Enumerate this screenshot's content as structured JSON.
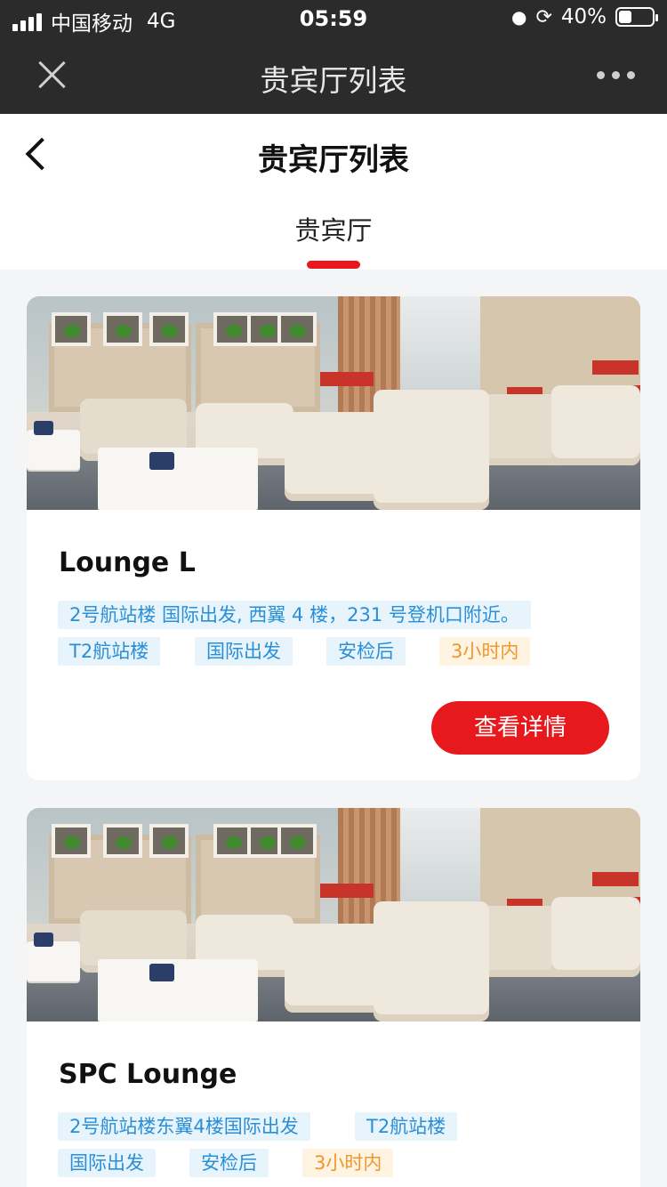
{
  "status_bar": {
    "carrier": "中国移动",
    "network": "4G",
    "time": "05:59",
    "battery_text": "40%",
    "battery_level": 0.4
  },
  "wechat_bar": {
    "title": "贵宾厅列表"
  },
  "page": {
    "title": "贵宾厅列表",
    "tab_label": "贵宾厅"
  },
  "lounges": [
    {
      "name": "Lounge L",
      "tags": [
        {
          "text": "2号航站楼 国际出发, 西翼 4 楼，231 号登机口附近。",
          "tone": "blue"
        },
        {
          "text": "T2航站楼",
          "tone": "blue"
        },
        {
          "text": "国际出发",
          "tone": "blue"
        },
        {
          "text": "安检后",
          "tone": "blue"
        },
        {
          "text": "3小时内",
          "tone": "orange"
        }
      ],
      "button_label": "查看详情"
    },
    {
      "name": "SPC Lounge",
      "tags": [
        {
          "text": "2号航站楼东翼4楼国际出发",
          "tone": "blue"
        },
        {
          "text": "T2航站楼",
          "tone": "blue"
        },
        {
          "text": "国际出发",
          "tone": "blue"
        },
        {
          "text": "安检后",
          "tone": "blue"
        },
        {
          "text": "3小时内",
          "tone": "orange"
        }
      ]
    }
  ],
  "colors": {
    "accent": "#e8191c",
    "tag_blue_text": "#2a8fd6",
    "tag_blue_bg": "#e8f4fc",
    "tag_orange_text": "#f0962a",
    "tag_orange_bg": "#fff4e2"
  }
}
